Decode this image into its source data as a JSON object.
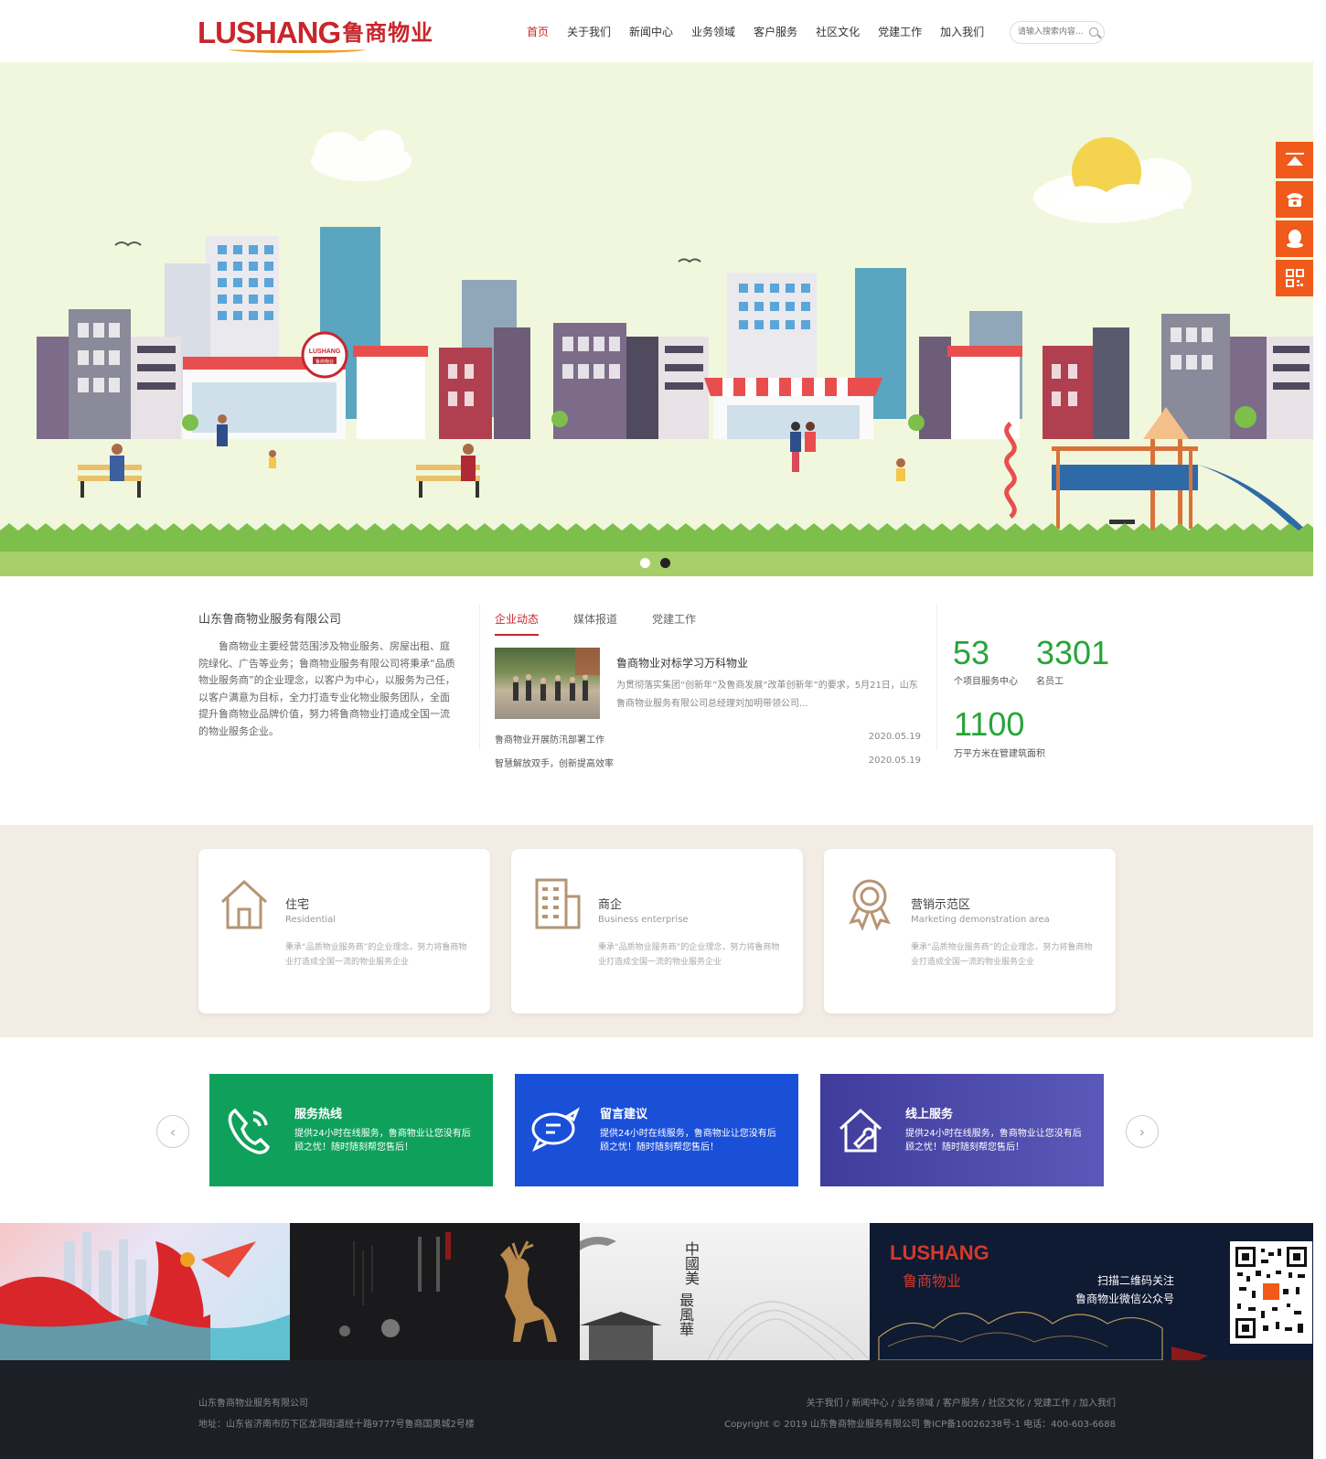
{
  "logo": {
    "en": "LUSHANG",
    "cn": "鲁商物业",
    "badge_en": "LUSHANG",
    "badge_cn": "鲁商物业"
  },
  "nav": [
    "首页",
    "关于我们",
    "新闻中心",
    "业务领域",
    "客户服务",
    "社区文化",
    "党建工作",
    "加入我们"
  ],
  "search": {
    "placeholder": "请输入搜索内容..."
  },
  "intro": {
    "title": "山东鲁商物业服务有限公司",
    "text": "鲁商物业主要经营范围涉及物业服务、房屋出租、庭院绿化、广告等业务；鲁商物业服务有限公司将秉承“品质物业服务商”的企业理念，以客户为中心，以服务为己任，以客户满意为目标，全力打造专业化物业服务团队，全面提升鲁商物业品牌价值，努力将鲁商物业打造成全国一流的物业服务企业。"
  },
  "tabs": [
    "企业动态",
    "媒体报道",
    "党建工作"
  ],
  "news": {
    "title": "鲁商物业对标学习万科物业",
    "desc": "为贯彻落实集团“创新年”及鲁商发展“改革创新年”的要求，5月21日，山东鲁商物业服务有限公司总经理刘加明带领公司...",
    "list": [
      {
        "title": "鲁商物业开展防汛部署工作",
        "date": "2020.05.19"
      },
      {
        "title": "智慧解放双手，创新提高效率",
        "date": "2020.05.19"
      }
    ]
  },
  "stats": [
    {
      "num": "53",
      "label": "个项目服务中心"
    },
    {
      "num": "3301",
      "label": "名员工"
    },
    {
      "num": "1100",
      "label": "万平方米在管建筑面积"
    }
  ],
  "services": [
    {
      "title": "住宅",
      "sub": "Residential",
      "desc": "秉承“品质物业服务商”的企业理念，努力将鲁商物业打造成全国一流的物业服务企业",
      "icon": "house-icon"
    },
    {
      "title": "商企",
      "sub": "Business enterprise",
      "desc": "秉承“品质物业服务商”的企业理念，努力将鲁商物业打造成全国一流的物业服务企业",
      "icon": "building-icon"
    },
    {
      "title": "营销示范区",
      "sub": "Marketing demonstration area",
      "desc": "秉承“品质物业服务商”的企业理念，努力将鲁商物业打造成全国一流的物业服务企业",
      "icon": "award-icon"
    }
  ],
  "ccards": [
    {
      "title": "服务热线",
      "desc": "提供24小时在线服务，鲁商物业让您没有后顾之忧！随时随刻帮您售后！",
      "color": "#0fa15c",
      "icon": "phone-icon"
    },
    {
      "title": "留言建议",
      "desc": "提供24小时在线服务，鲁商物业让您没有后顾之忧！随时随刻帮您售后！",
      "color": "#1a4fd8",
      "icon": "message-icon"
    },
    {
      "title": "线上服务",
      "desc": "提供24小时在线服务，鲁商物业让您没有后顾之忧！随时随刻帮您售后！",
      "color": "#4a4aa8",
      "icon": "home-service-icon"
    }
  ],
  "culture": {
    "p3_text1": "中國美",
    "p3_text2": "最風華",
    "p4_logo_en": "LUSHANG",
    "p4_logo_cn": "鲁商物业",
    "p4_l1": "扫描二维码关注",
    "p4_l2": "鲁商物业微信公众号"
  },
  "footer": {
    "company": "山东鲁商物业服务有限公司",
    "address": "地址：山东省济南市历下区龙洞街道经十路9777号鲁商国奥城2号楼",
    "links": "关于我们 / 新闻中心 / 业务领域 / 客户服务 / 社区文化 / 党建工作 / 加入我们",
    "copyright": "Copyright © 2019 山东鲁商物业服务有限公司 鲁ICP备10026238号-1  电话：400-603-6688"
  },
  "colors": {
    "brand": "#c8262c",
    "accent": "#f05a1a",
    "stat": "#27a53a"
  }
}
